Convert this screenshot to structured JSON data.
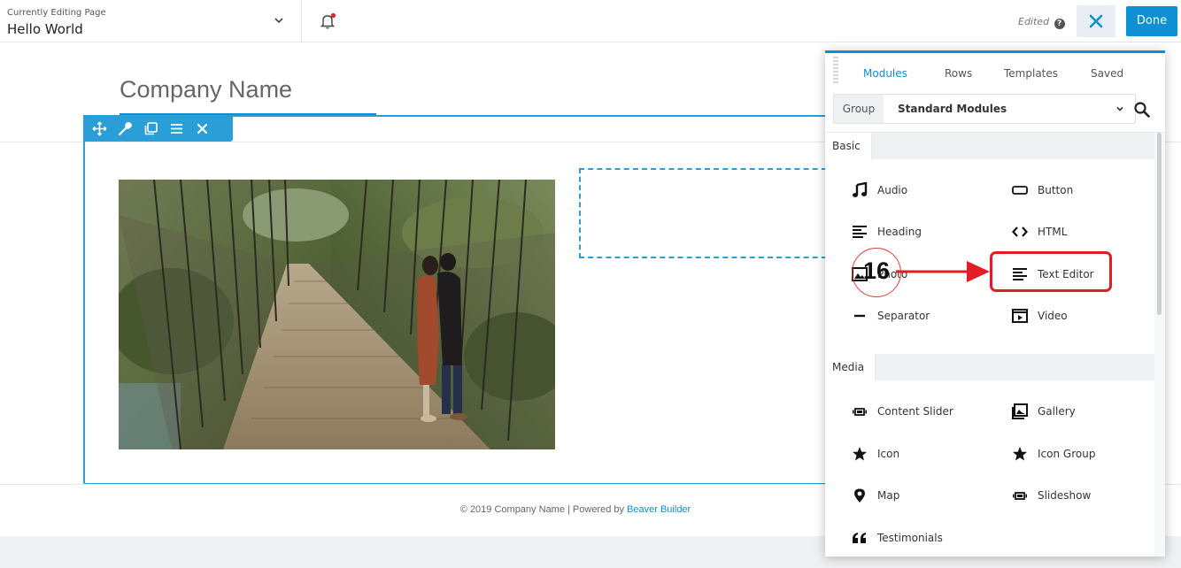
{
  "topbar": {
    "editing_label": "Currently Editing Page",
    "page_title": "Hello World",
    "edited_label": "Edited",
    "help_glyph": "?",
    "done_label": "Done"
  },
  "page": {
    "company_name": "Company Name",
    "footer_prefix": "© 2019 Company Name | Powered by ",
    "footer_link": "Beaver Builder"
  },
  "panel": {
    "tabs": [
      "Modules",
      "Rows",
      "Templates",
      "Saved"
    ],
    "active_tab": "Modules",
    "group_label": "Group",
    "group_value": "Standard Modules",
    "sections": [
      {
        "title": "Basic",
        "modules": [
          {
            "label": "Audio",
            "icon": "music-note-icon"
          },
          {
            "label": "Button",
            "icon": "button-outline-icon"
          },
          {
            "label": "Heading",
            "icon": "heading-lines-icon"
          },
          {
            "label": "HTML",
            "icon": "code-brackets-icon"
          },
          {
            "label": "Photo",
            "icon": "photo-icon"
          },
          {
            "label": "Text Editor",
            "icon": "text-lines-icon"
          },
          {
            "label": "Separator",
            "icon": "separator-line-icon"
          },
          {
            "label": "Video",
            "icon": "video-icon"
          }
        ]
      },
      {
        "title": "Media",
        "modules": [
          {
            "label": "Content Slider",
            "icon": "slider-icon"
          },
          {
            "label": "Gallery",
            "icon": "gallery-icon"
          },
          {
            "label": "Icon",
            "icon": "star-icon"
          },
          {
            "label": "Icon Group",
            "icon": "star-icon"
          },
          {
            "label": "Map",
            "icon": "map-pin-icon"
          },
          {
            "label": "Slideshow",
            "icon": "slider-icon"
          },
          {
            "label": "Testimonials",
            "icon": "quote-icon"
          }
        ]
      }
    ]
  },
  "annotation": {
    "step_number": "16",
    "color": "#e21d23"
  },
  "colors": {
    "accent": "#0e90d2",
    "outline": "#2a9ed6"
  }
}
